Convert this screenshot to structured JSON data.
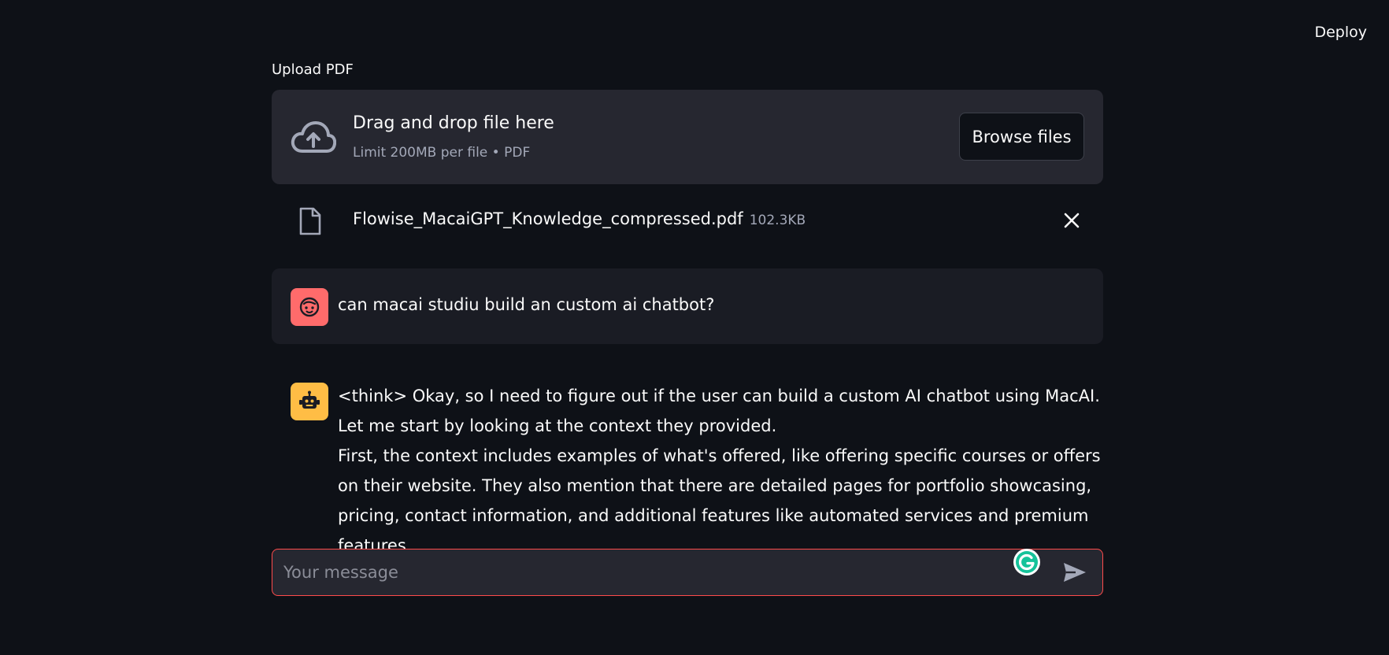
{
  "header": {
    "deploy_label": "Deploy"
  },
  "uploader": {
    "label": "Upload PDF",
    "dropzone_title": "Drag and drop file here",
    "dropzone_limit": "Limit 200MB per file • PDF",
    "browse_label": "Browse files",
    "cloud_icon": "cloud-upload-icon"
  },
  "uploaded_file": {
    "name": "Flowise_MacaiGPT_Knowledge_compressed.pdf",
    "size": "102.3KB",
    "icon": "file-icon"
  },
  "messages": [
    {
      "role": "user",
      "avatar_color": "#ff6b6b",
      "text": "can macai studiu build an custom ai chatbot?"
    },
    {
      "role": "assistant",
      "avatar_color": "#ffbd45",
      "paragraphs": [
        "<think> Okay, so I need to figure out if the user can build a custom AI chatbot using MacAI. Let me start by looking at the context they provided.",
        "First, the context includes examples of what's offered, like offering specific courses or offers on their website. They also mention that there are detailed pages for portfolio showcasing, pricing, contact information, and additional features like automated services and premium features."
      ]
    }
  ],
  "chat_input": {
    "placeholder": "Your message",
    "value": ""
  },
  "colors": {
    "background": "#0e1117",
    "surface": "#262730",
    "accent": "#ff4b4b"
  }
}
